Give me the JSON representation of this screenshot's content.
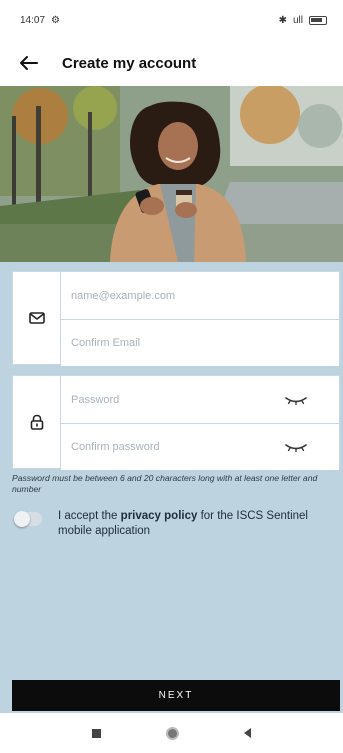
{
  "status_bar": {
    "time": "14:07",
    "signal_text": "ull"
  },
  "app_bar": {
    "title": "Create my account"
  },
  "email_group": {
    "email_placeholder": "name@example.com",
    "confirm_email_placeholder": "Confirm Email"
  },
  "password_group": {
    "password_placeholder": "Password",
    "confirm_password_placeholder": "Confirm password"
  },
  "hint": "Password must be between 6 and 20 characters long with at least one letter and number",
  "consent": {
    "prefix": "I accept the",
    "link": "privacy policy",
    "suffix": "for the ISCS Sentinel mobile application",
    "enabled": false
  },
  "next_button": {
    "label": "NEXT"
  },
  "colors": {
    "background": "#bed3e0",
    "button": "#0c0c0c",
    "field_border": "#c9d7e0"
  },
  "icons": [
    "back-arrow-icon",
    "envelope-icon",
    "lock-icon",
    "eye-closed-icon"
  ]
}
